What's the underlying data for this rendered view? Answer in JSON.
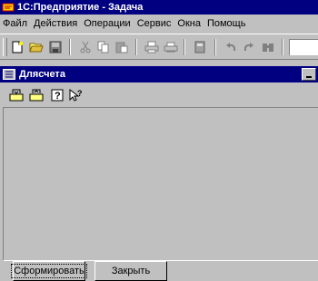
{
  "app": {
    "title": "1С:Предприятие - Задача"
  },
  "menu": {
    "items": [
      {
        "label": "Файл"
      },
      {
        "label": "Действия"
      },
      {
        "label": "Операции"
      },
      {
        "label": "Сервис"
      },
      {
        "label": "Окна"
      },
      {
        "label": "Помощь"
      }
    ]
  },
  "toolbar": {
    "icons": [
      "new-document-icon",
      "open-folder-icon",
      "save-icon",
      "cut-icon",
      "copy-icon",
      "paste-icon",
      "print-icon",
      "print-preview-icon",
      "calculator-icon",
      "undo-icon",
      "redo-icon",
      "find-icon"
    ]
  },
  "document": {
    "title": "Длясчета",
    "toolbar_icons": [
      "open-icon",
      "save-as-icon",
      "help-icon",
      "context-help-icon"
    ]
  },
  "buttons": {
    "form": "Сформировать",
    "close": "Закрыть"
  },
  "colors": {
    "titlebar": "#000080",
    "face": "#c0c0c0"
  }
}
